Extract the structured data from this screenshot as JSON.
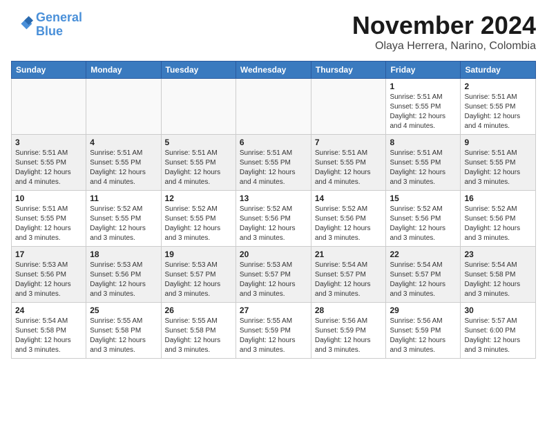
{
  "header": {
    "logo_line1": "General",
    "logo_line2": "Blue",
    "month": "November 2024",
    "location": "Olaya Herrera, Narino, Colombia"
  },
  "days_of_week": [
    "Sunday",
    "Monday",
    "Tuesday",
    "Wednesday",
    "Thursday",
    "Friday",
    "Saturday"
  ],
  "weeks": [
    [
      {
        "num": "",
        "info": ""
      },
      {
        "num": "",
        "info": ""
      },
      {
        "num": "",
        "info": ""
      },
      {
        "num": "",
        "info": ""
      },
      {
        "num": "",
        "info": ""
      },
      {
        "num": "1",
        "info": "Sunrise: 5:51 AM\nSunset: 5:55 PM\nDaylight: 12 hours\nand 4 minutes."
      },
      {
        "num": "2",
        "info": "Sunrise: 5:51 AM\nSunset: 5:55 PM\nDaylight: 12 hours\nand 4 minutes."
      }
    ],
    [
      {
        "num": "3",
        "info": "Sunrise: 5:51 AM\nSunset: 5:55 PM\nDaylight: 12 hours\nand 4 minutes."
      },
      {
        "num": "4",
        "info": "Sunrise: 5:51 AM\nSunset: 5:55 PM\nDaylight: 12 hours\nand 4 minutes."
      },
      {
        "num": "5",
        "info": "Sunrise: 5:51 AM\nSunset: 5:55 PM\nDaylight: 12 hours\nand 4 minutes."
      },
      {
        "num": "6",
        "info": "Sunrise: 5:51 AM\nSunset: 5:55 PM\nDaylight: 12 hours\nand 4 minutes."
      },
      {
        "num": "7",
        "info": "Sunrise: 5:51 AM\nSunset: 5:55 PM\nDaylight: 12 hours\nand 4 minutes."
      },
      {
        "num": "8",
        "info": "Sunrise: 5:51 AM\nSunset: 5:55 PM\nDaylight: 12 hours\nand 3 minutes."
      },
      {
        "num": "9",
        "info": "Sunrise: 5:51 AM\nSunset: 5:55 PM\nDaylight: 12 hours\nand 3 minutes."
      }
    ],
    [
      {
        "num": "10",
        "info": "Sunrise: 5:51 AM\nSunset: 5:55 PM\nDaylight: 12 hours\nand 3 minutes."
      },
      {
        "num": "11",
        "info": "Sunrise: 5:52 AM\nSunset: 5:55 PM\nDaylight: 12 hours\nand 3 minutes."
      },
      {
        "num": "12",
        "info": "Sunrise: 5:52 AM\nSunset: 5:55 PM\nDaylight: 12 hours\nand 3 minutes."
      },
      {
        "num": "13",
        "info": "Sunrise: 5:52 AM\nSunset: 5:56 PM\nDaylight: 12 hours\nand 3 minutes."
      },
      {
        "num": "14",
        "info": "Sunrise: 5:52 AM\nSunset: 5:56 PM\nDaylight: 12 hours\nand 3 minutes."
      },
      {
        "num": "15",
        "info": "Sunrise: 5:52 AM\nSunset: 5:56 PM\nDaylight: 12 hours\nand 3 minutes."
      },
      {
        "num": "16",
        "info": "Sunrise: 5:52 AM\nSunset: 5:56 PM\nDaylight: 12 hours\nand 3 minutes."
      }
    ],
    [
      {
        "num": "17",
        "info": "Sunrise: 5:53 AM\nSunset: 5:56 PM\nDaylight: 12 hours\nand 3 minutes."
      },
      {
        "num": "18",
        "info": "Sunrise: 5:53 AM\nSunset: 5:56 PM\nDaylight: 12 hours\nand 3 minutes."
      },
      {
        "num": "19",
        "info": "Sunrise: 5:53 AM\nSunset: 5:57 PM\nDaylight: 12 hours\nand 3 minutes."
      },
      {
        "num": "20",
        "info": "Sunrise: 5:53 AM\nSunset: 5:57 PM\nDaylight: 12 hours\nand 3 minutes."
      },
      {
        "num": "21",
        "info": "Sunrise: 5:54 AM\nSunset: 5:57 PM\nDaylight: 12 hours\nand 3 minutes."
      },
      {
        "num": "22",
        "info": "Sunrise: 5:54 AM\nSunset: 5:57 PM\nDaylight: 12 hours\nand 3 minutes."
      },
      {
        "num": "23",
        "info": "Sunrise: 5:54 AM\nSunset: 5:58 PM\nDaylight: 12 hours\nand 3 minutes."
      }
    ],
    [
      {
        "num": "24",
        "info": "Sunrise: 5:54 AM\nSunset: 5:58 PM\nDaylight: 12 hours\nand 3 minutes."
      },
      {
        "num": "25",
        "info": "Sunrise: 5:55 AM\nSunset: 5:58 PM\nDaylight: 12 hours\nand 3 minutes."
      },
      {
        "num": "26",
        "info": "Sunrise: 5:55 AM\nSunset: 5:58 PM\nDaylight: 12 hours\nand 3 minutes."
      },
      {
        "num": "27",
        "info": "Sunrise: 5:55 AM\nSunset: 5:59 PM\nDaylight: 12 hours\nand 3 minutes."
      },
      {
        "num": "28",
        "info": "Sunrise: 5:56 AM\nSunset: 5:59 PM\nDaylight: 12 hours\nand 3 minutes."
      },
      {
        "num": "29",
        "info": "Sunrise: 5:56 AM\nSunset: 5:59 PM\nDaylight: 12 hours\nand 3 minutes."
      },
      {
        "num": "30",
        "info": "Sunrise: 5:57 AM\nSunset: 6:00 PM\nDaylight: 12 hours\nand 3 minutes."
      }
    ]
  ]
}
